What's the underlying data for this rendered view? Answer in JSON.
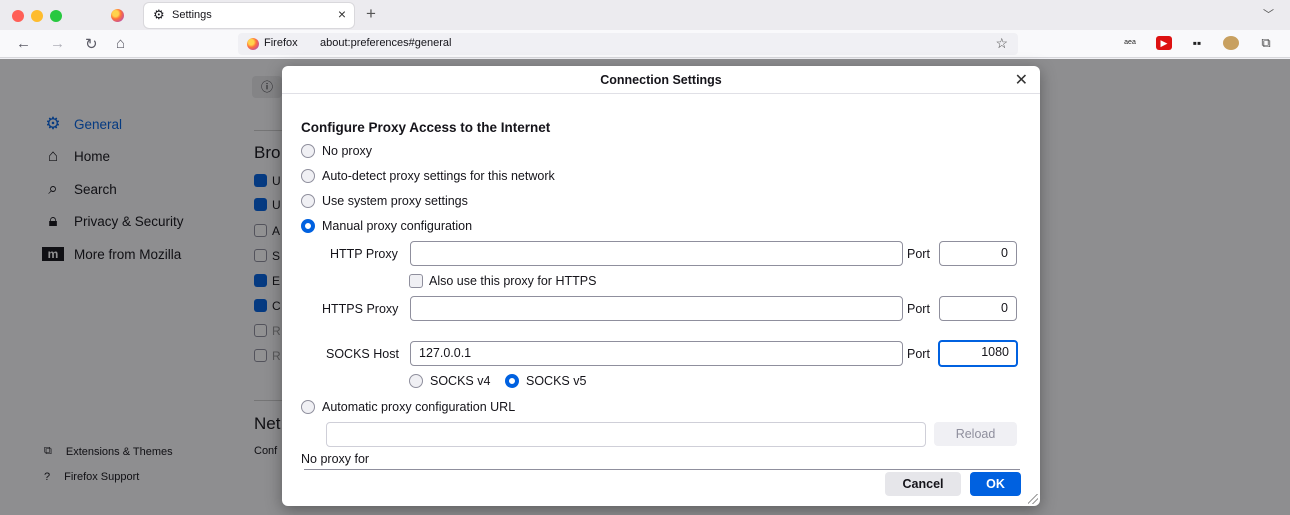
{
  "browser": {
    "tab_title": "Settings",
    "url_brand": "Firefox",
    "url": "about:preferences#general",
    "extension_label": "aea"
  },
  "sidebar": {
    "items": [
      {
        "label": "General",
        "icon": "gear-icon",
        "active": true
      },
      {
        "label": "Home",
        "icon": "home-icon"
      },
      {
        "label": "Search",
        "icon": "search-icon"
      },
      {
        "label": "Privacy & Security",
        "icon": "lock-icon"
      },
      {
        "label": "More from Mozilla",
        "icon": "mozilla-icon"
      }
    ],
    "footer": [
      {
        "label": "Extensions & Themes",
        "icon": "puzzle-icon"
      },
      {
        "label": "Firefox Support",
        "icon": "help-icon"
      }
    ]
  },
  "background": {
    "browsing_heading": "Bro",
    "network_heading": "Net",
    "network_text": "Conf",
    "checkbox_letters": [
      "U",
      "U",
      "A",
      "S",
      "E",
      "C",
      "R",
      "R"
    ]
  },
  "dialog": {
    "title": "Connection Settings",
    "heading": "Configure Proxy Access to the Internet",
    "options": {
      "no_proxy": "No proxy",
      "auto_detect": "Auto-detect proxy settings for this network",
      "system": "Use system proxy settings",
      "manual": "Manual proxy configuration",
      "auto_url": "Automatic proxy configuration URL"
    },
    "selected_option": "manual",
    "http_proxy": {
      "label": "HTTP Proxy",
      "value": "",
      "port_label": "Port",
      "port": "0"
    },
    "also_https": "Also use this proxy for HTTPS",
    "https_proxy": {
      "label": "HTTPS Proxy",
      "value": "",
      "port_label": "Port",
      "port": "0"
    },
    "socks": {
      "label": "SOCKS Host",
      "value": "127.0.0.1",
      "port_label": "Port",
      "port": "1080",
      "v4": "SOCKS v4",
      "v5": "SOCKS v5",
      "selected": "v5"
    },
    "auto_url_value": "",
    "reload": "Reload",
    "no_proxy_for": "No proxy for",
    "cancel": "Cancel",
    "ok": "OK"
  },
  "colors": {
    "accent": "#0061e0",
    "overlay": "rgba(12,12,13,0.45)"
  }
}
